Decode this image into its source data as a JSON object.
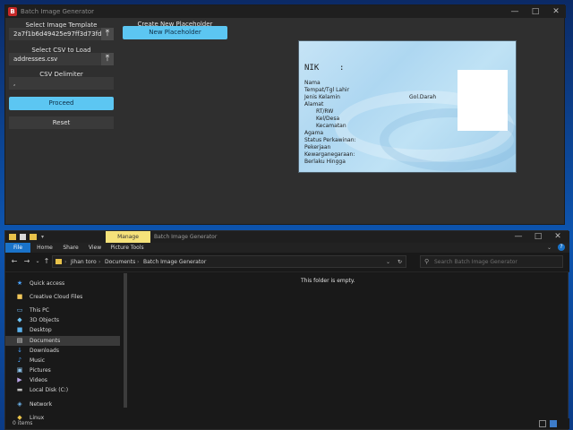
{
  "app": {
    "title": "Batch Image Generator",
    "select_template_label": "Select Image Template",
    "template_value": "2a7f1b6d49425e97ff3d73fd:",
    "select_csv_label": "Select CSV to Load",
    "csv_value": "addresses.csv",
    "csv_delimiter_label": "CSV Delimiter",
    "delimiter_value": ",",
    "proceed_label": "Proceed",
    "reset_label": "Reset",
    "create_placeholder_label": "Create New Placeholder",
    "new_placeholder_label": "New Placeholder",
    "upload_glyph": "⤒",
    "window_controls": [
      "—",
      "□",
      "✕"
    ]
  },
  "id_card": {
    "nik_label": "NIK",
    "nik_colon": ":",
    "fields": {
      "nama": "Nama",
      "ttl": "Tempat/Tgl Lahir",
      "jk": "Jenis Kelamin",
      "goldarah": "Gol.Darah",
      "alamat": "Alamat",
      "rtrw": "RT/RW",
      "keldesa": "Kel/Desa",
      "kecamatan": "Kecamatan",
      "agama": "Agama",
      "status": "Status Perkawinan:",
      "pekerjaan": "Pekerjaan",
      "kewarganegaraan": "Kewarganegaraan:",
      "berlaku": "Berlaku Hingga"
    }
  },
  "explorer": {
    "manage_tab": "Manage",
    "window_title": "Batch Image Generator",
    "ribbon_tabs": [
      "File",
      "Home",
      "Share",
      "View",
      "Picture Tools"
    ],
    "breadcrumbs": [
      "Jihan toro",
      "Documents",
      "Batch Image Generator"
    ],
    "search_placeholder": "Search Batch Image Generator",
    "empty_message": "This folder is empty.",
    "status": "0 items",
    "nav_items": [
      {
        "label": "Quick access",
        "icon": "star-icon",
        "color": "#4aa3ff"
      },
      {
        "label": "Creative Cloud Files",
        "icon": "cloud-folder-icon",
        "color": "#f1c75a"
      },
      {
        "label": "This PC",
        "icon": "computer-icon",
        "color": "#6fb7f0"
      },
      {
        "label": "3D Objects",
        "icon": "cube-icon",
        "color": "#6ec3f5"
      },
      {
        "label": "Desktop",
        "icon": "desktop-folder-icon",
        "color": "#5ab0ea"
      },
      {
        "label": "Documents",
        "icon": "documents-icon",
        "color": "#d8d8d8"
      },
      {
        "label": "Downloads",
        "icon": "download-icon",
        "color": "#4aa3ff"
      },
      {
        "label": "Music",
        "icon": "music-icon",
        "color": "#4aa3ff"
      },
      {
        "label": "Pictures",
        "icon": "pictures-icon",
        "color": "#8fc7f0"
      },
      {
        "label": "Videos",
        "icon": "videos-icon",
        "color": "#b9a4e6"
      },
      {
        "label": "Local Disk (C:)",
        "icon": "drive-icon",
        "color": "#bdbdbd"
      },
      {
        "label": "Network",
        "icon": "network-icon",
        "color": "#6fb7f0"
      },
      {
        "label": "Linux",
        "icon": "linux-icon",
        "color": "#e8c24a"
      }
    ],
    "selected_nav": "Documents"
  }
}
